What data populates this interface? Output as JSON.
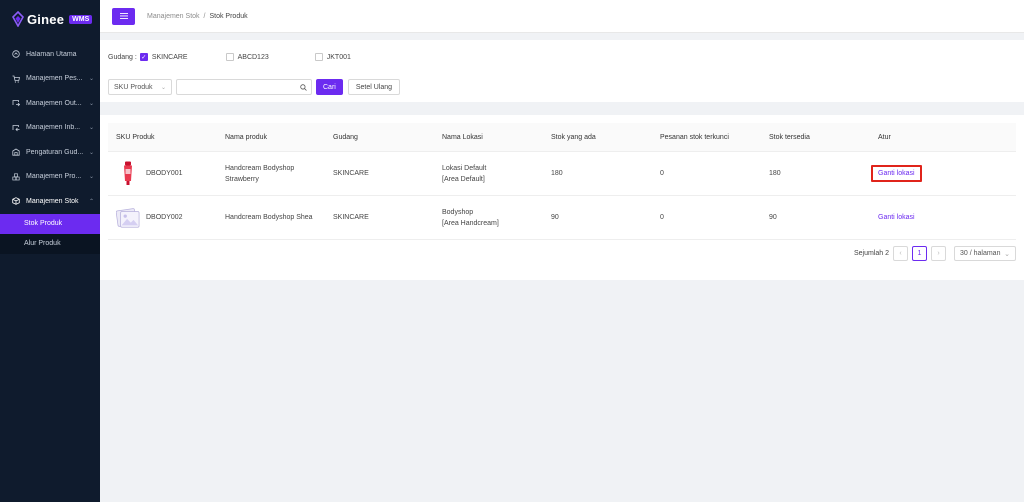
{
  "app": {
    "logo_text": "Ginee",
    "logo_badge": "WMS",
    "brand_color": "#6c2bf0",
    "sidebar_bg": "#0f1b2d"
  },
  "sidebar": {
    "items": [
      {
        "label": "Halaman Utama",
        "icon": "home-icon"
      },
      {
        "label": "Manajemen Pes...",
        "icon": "cart-icon"
      },
      {
        "label": "Manajemen Out...",
        "icon": "outbound-icon"
      },
      {
        "label": "Manajemen Inb...",
        "icon": "inbound-icon"
      },
      {
        "label": "Pengaturan Gud...",
        "icon": "warehouse-icon"
      },
      {
        "label": "Manajemen Pro...",
        "icon": "product-icon"
      },
      {
        "label": "Manajemen Stok",
        "icon": "box-icon"
      }
    ],
    "sub_items": [
      {
        "label": "Stok Produk",
        "active": true
      },
      {
        "label": "Alur Produk",
        "active": false
      }
    ]
  },
  "header": {
    "breadcrumb_parent": "Manajemen Stok",
    "breadcrumb_sep": "/",
    "breadcrumb_current": "Stok Produk"
  },
  "filter": {
    "warehouse_label": "Gudang :",
    "warehouses": [
      {
        "label": "SKINCARE",
        "checked": true
      },
      {
        "label": "ABCD123",
        "checked": false
      },
      {
        "label": "JKT001",
        "checked": false
      }
    ],
    "search_field": "SKU Produk",
    "search_value": "",
    "search_button": "Cari",
    "reset_button": "Setel Ulang"
  },
  "table": {
    "columns": [
      "SKU Produk",
      "Nama produk",
      "Gudang",
      "Nama Lokasi",
      "Stok yang ada",
      "Pesanan stok terkunci",
      "Stok tersedia",
      "Atur"
    ],
    "rows": [
      {
        "sku": "DBODY001",
        "name_line1": "Handcream Bodyshop",
        "name_line2": "Strawberry",
        "warehouse": "SKINCARE",
        "loc_line1": "Lokasi Default",
        "loc_line2": "[Area Default]",
        "stock": "180",
        "locked": "0",
        "available": "180",
        "action": "Ganti lokasi",
        "thumb": "product-photo"
      },
      {
        "sku": "DBODY002",
        "name_line1": "Handcream Bodyshop Shea",
        "name_line2": "",
        "warehouse": "SKINCARE",
        "loc_line1": "Bodyshop",
        "loc_line2": "[Area Handcream]",
        "stock": "90",
        "locked": "0",
        "available": "90",
        "action": "Ganti lokasi",
        "thumb": "image-placeholder"
      }
    ]
  },
  "pager": {
    "total": "Sejumlah 2",
    "current_page": "1",
    "page_size": "30 / halaman"
  }
}
